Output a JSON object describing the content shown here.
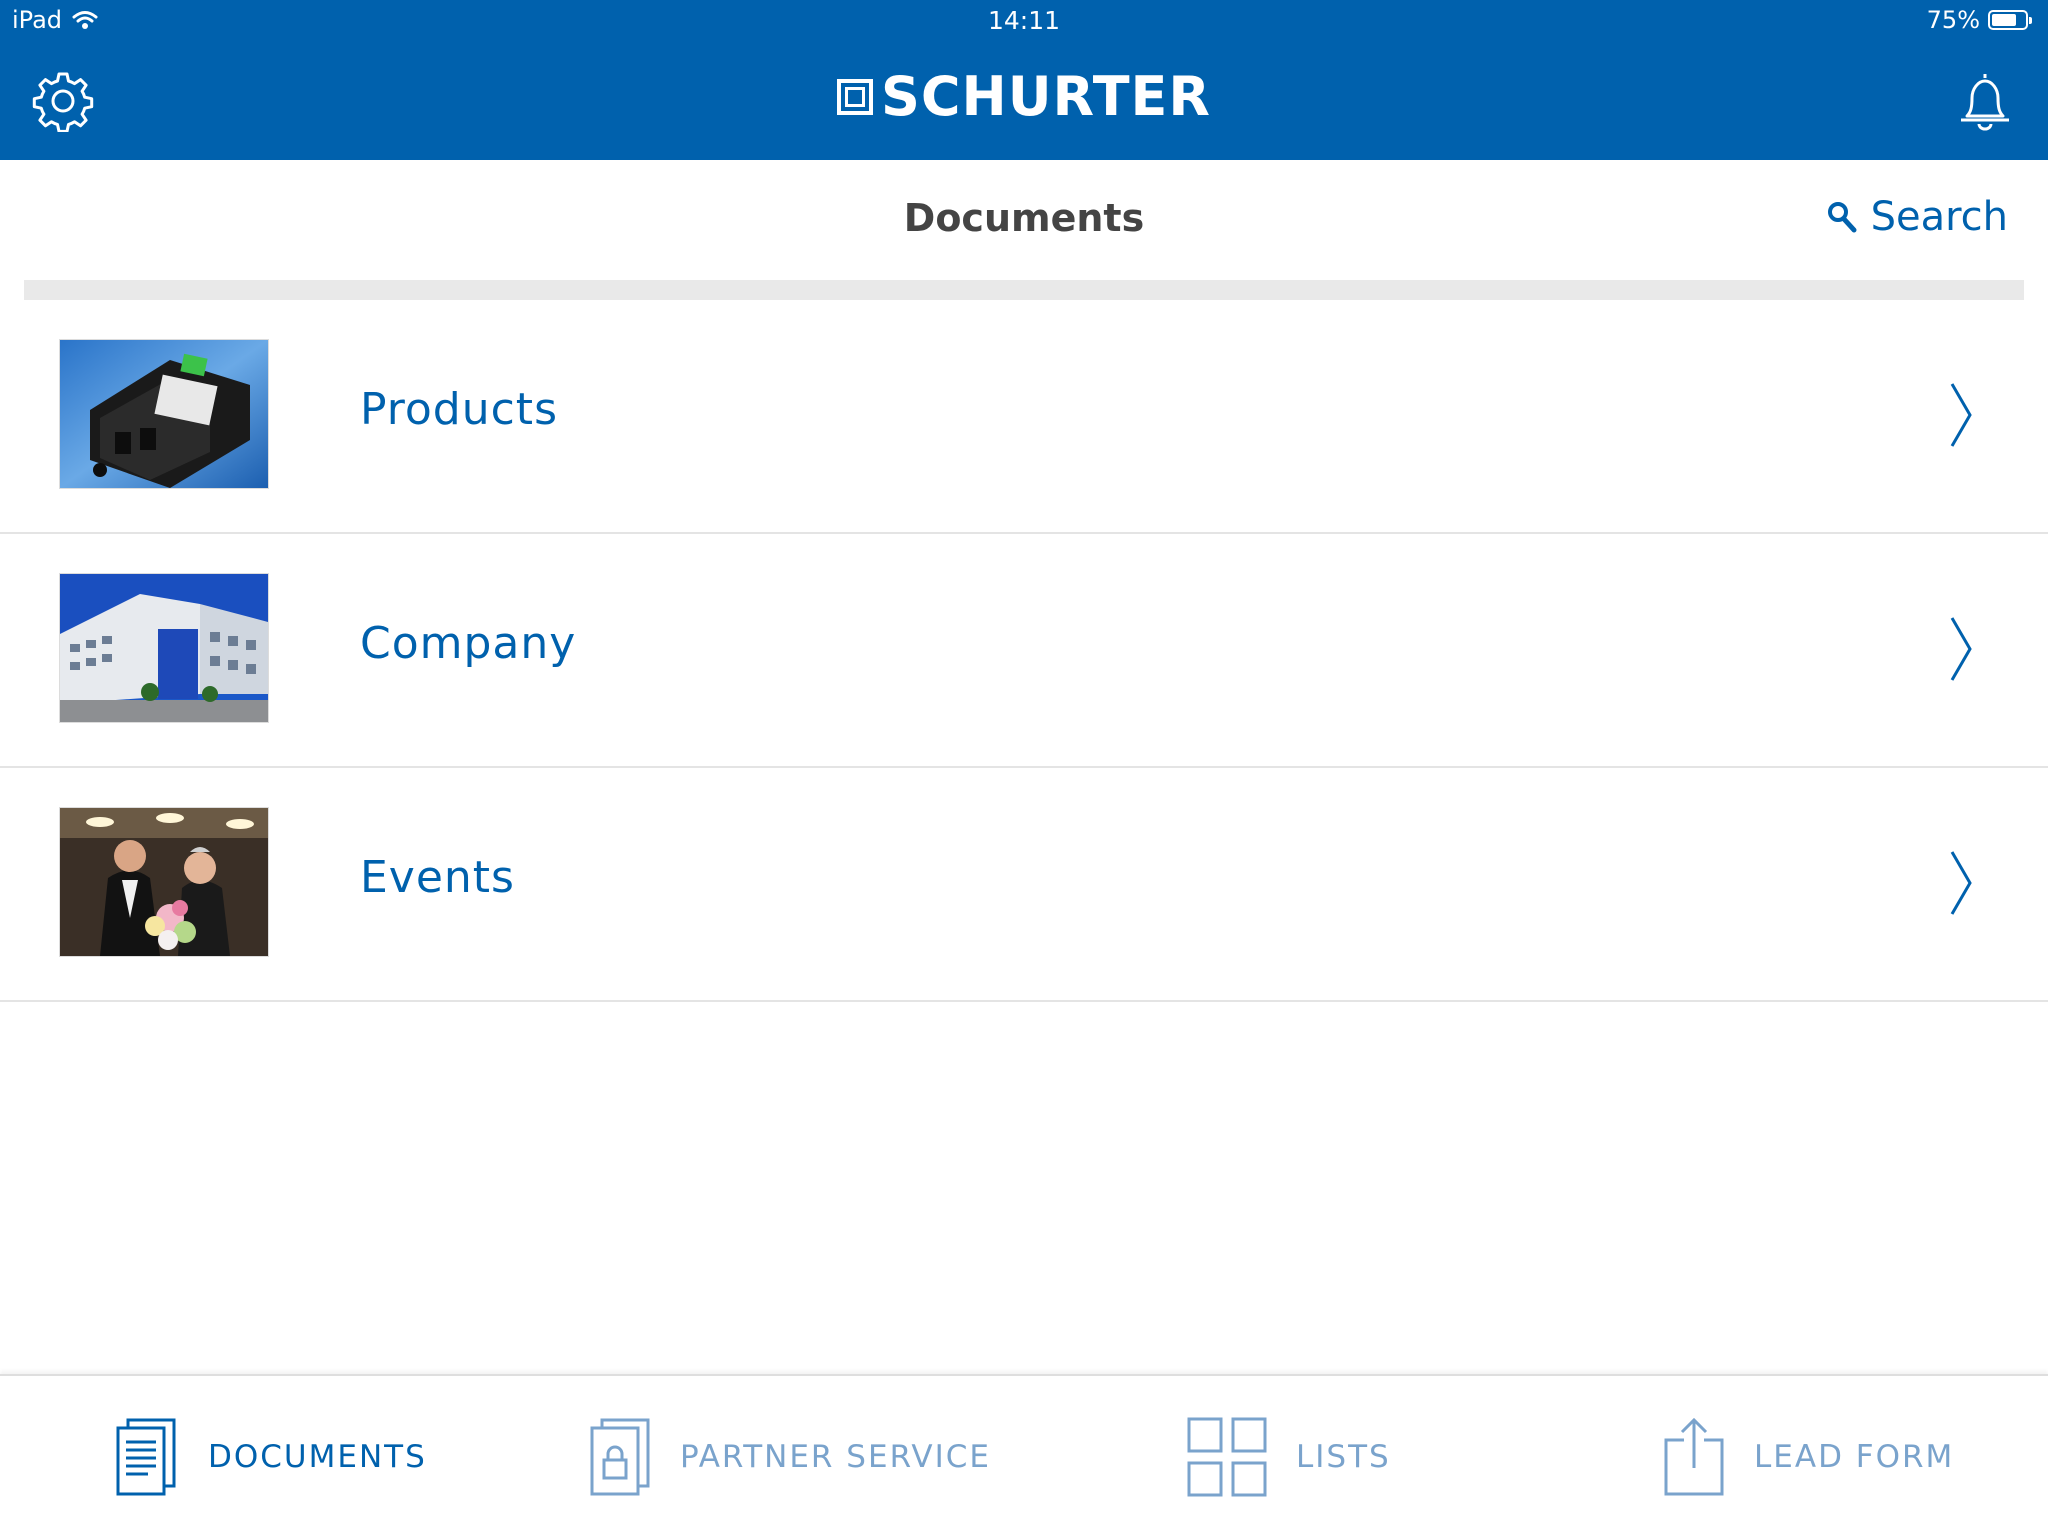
{
  "status_bar": {
    "device": "iPad",
    "time": "14:11",
    "battery_text": "75%",
    "battery_level": 0.75
  },
  "header": {
    "brand": "SCHURTER",
    "settings_icon": "gear-icon",
    "notifications_icon": "bell-icon",
    "color": "#0061ad"
  },
  "subheader": {
    "title": "Documents",
    "search_label": "Search"
  },
  "list_items": [
    {
      "label": "Products",
      "thumbnail": "product-photo"
    },
    {
      "label": "Company",
      "thumbnail": "building-photo"
    },
    {
      "label": "Events",
      "thumbnail": "event-photo"
    }
  ],
  "tabs": [
    {
      "label": "DOCUMENTS",
      "icon": "documents-icon",
      "active": true
    },
    {
      "label": "PARTNER SERVICE",
      "icon": "lock-document-icon",
      "active": false
    },
    {
      "label": "LISTS",
      "icon": "grid-icon",
      "active": false
    },
    {
      "label": "LEAD FORM",
      "icon": "share-upload-icon",
      "active": false
    }
  ],
  "colors": {
    "accent": "#0061ad",
    "inactive_tab": "#7aa3cc",
    "title_text": "#444444"
  }
}
